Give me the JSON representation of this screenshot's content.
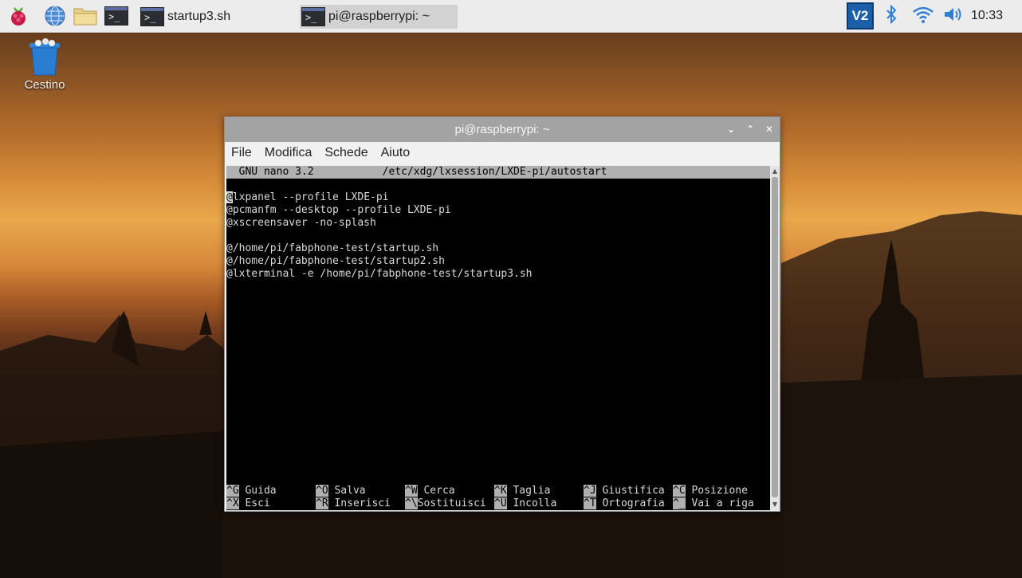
{
  "taskbar": {
    "tasks": [
      {
        "label": "startup3.sh"
      },
      {
        "label": "pi@raspberrypi: ~"
      }
    ],
    "clock": "10:33",
    "icons": [
      "raspberry-menu-icon",
      "web-browser-icon",
      "file-manager-icon",
      "terminal-icon",
      "vnc-icon",
      "bluetooth-icon",
      "wifi-icon",
      "volume-icon"
    ]
  },
  "desktop": {
    "icons": [
      {
        "label": "Cestino",
        "icon": "trash-icon"
      }
    ]
  },
  "window": {
    "title": "pi@raspberrypi: ~",
    "menu": [
      "File",
      "Modifica",
      "Schede",
      "Aiuto"
    ],
    "nano": {
      "version": "GNU nano 3.2",
      "file": "/etc/xdg/lxsession/LXDE-pi/autostart",
      "cursor_char": "@",
      "lines": [
        "lxpanel --profile LXDE-pi",
        "@pcmanfm --desktop --profile LXDE-pi",
        "@xscreensaver -no-splash",
        "",
        "@/home/pi/fabphone-test/startup.sh",
        "@/home/pi/fabphone-test/startup2.sh",
        "@lxterminal -e /home/pi/fabphone-test/startup3.sh"
      ],
      "help_row1": [
        {
          "key": "^G",
          "label": "Guida"
        },
        {
          "key": "^O",
          "label": "Salva"
        },
        {
          "key": "^W",
          "label": "Cerca"
        },
        {
          "key": "^K",
          "label": "Taglia"
        },
        {
          "key": "^J",
          "label": "Giustifica"
        },
        {
          "key": "^C",
          "label": "Posizione"
        }
      ],
      "help_row2": [
        {
          "key": "^X",
          "label": "Esci"
        },
        {
          "key": "^R",
          "label": "Inserisci"
        },
        {
          "key": "^\\",
          "label": "Sostituisci"
        },
        {
          "key": "^U",
          "label": "Incolla"
        },
        {
          "key": "^T",
          "label": "Ortografia"
        },
        {
          "key": "^_",
          "label": "Vai a riga"
        }
      ]
    }
  },
  "colors": {
    "taskbar_bg": "#ececec",
    "titlebar_bg": "#a3a3a3",
    "terminal_bg": "#000000",
    "nano_header_bg": "#b0b0b0"
  }
}
